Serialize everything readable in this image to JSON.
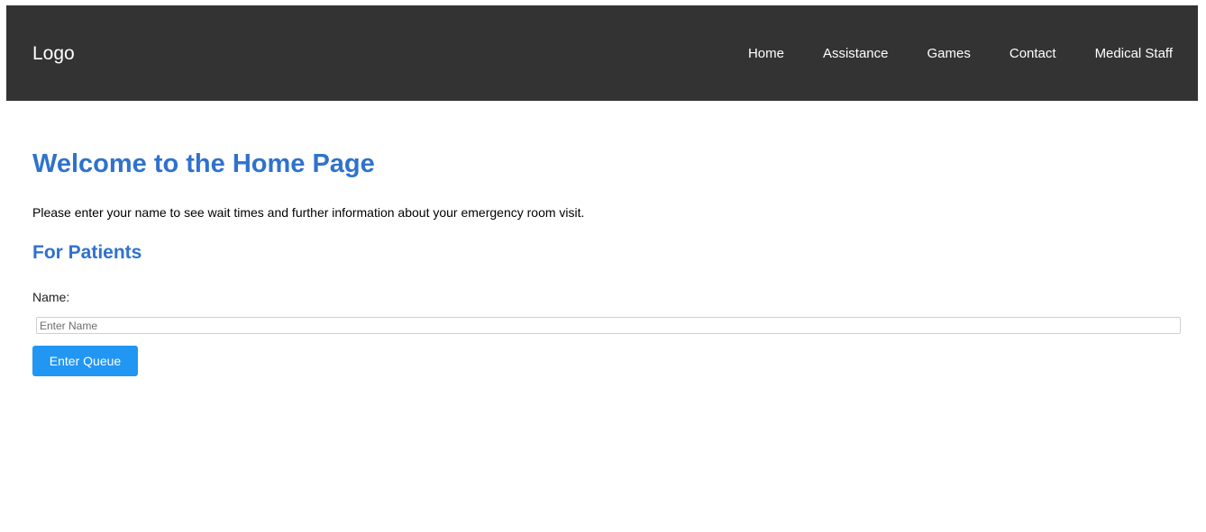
{
  "header": {
    "logo": "Logo",
    "nav": [
      {
        "label": "Home"
      },
      {
        "label": "Assistance"
      },
      {
        "label": "Games"
      },
      {
        "label": "Contact"
      },
      {
        "label": "Medical Staff"
      }
    ],
    "background_color": "#333333"
  },
  "main": {
    "title": "Welcome to the Home Page",
    "intro": "Please enter your name to see wait times and further information about your emergency room visit.",
    "section_title": "For Patients",
    "form": {
      "name_label": "Name:",
      "name_value": "",
      "name_placeholder": "Enter Name",
      "submit_label": "Enter Queue"
    },
    "accent_color": "#2f72cc",
    "button_color": "#2196f3"
  }
}
